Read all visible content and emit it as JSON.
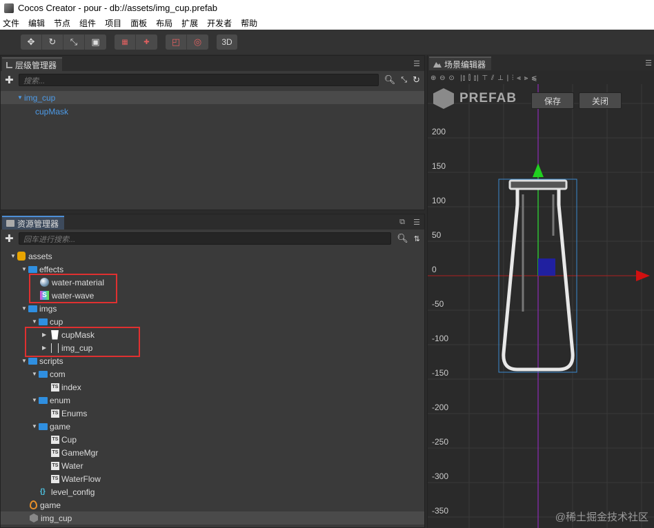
{
  "window": {
    "title": "Cocos Creator - pour - db://assets/img_cup.prefab"
  },
  "menu": [
    "文件",
    "编辑",
    "节点",
    "组件",
    "项目",
    "面板",
    "布局",
    "扩展",
    "开发者",
    "帮助"
  ],
  "toolbar": {
    "mode_3d": "3D"
  },
  "hierarchy": {
    "tab": "层级管理器",
    "search_placeholder": "搜索...",
    "nodes": [
      {
        "label": "img_cup"
      },
      {
        "label": "cupMask"
      }
    ]
  },
  "assets": {
    "tab": "资源管理器",
    "search_placeholder": "回车进行搜索...",
    "items": [
      {
        "label": "assets"
      },
      {
        "label": "effects"
      },
      {
        "label": "water-material"
      },
      {
        "label": "water-wave"
      },
      {
        "label": "imgs"
      },
      {
        "label": "cup"
      },
      {
        "label": "cupMask"
      },
      {
        "label": "img_cup"
      },
      {
        "label": "scripts"
      },
      {
        "label": "com"
      },
      {
        "label": "index"
      },
      {
        "label": "enum"
      },
      {
        "label": "Enums"
      },
      {
        "label": "game"
      },
      {
        "label": "Cup"
      },
      {
        "label": "GameMgr"
      },
      {
        "label": "Water"
      },
      {
        "label": "WaterFlow"
      },
      {
        "label": "level_config"
      },
      {
        "label": "game"
      },
      {
        "label": "img_cup"
      }
    ]
  },
  "scene": {
    "tab": "场景编辑器",
    "prefab_label": "PREFAB",
    "save_button": "保存",
    "close_button": "关闭",
    "ruler": [
      "200",
      "150",
      "100",
      "50",
      "0",
      "-50",
      "-100",
      "-150",
      "-200",
      "-250",
      "-300",
      "-350"
    ]
  },
  "watermark": "@稀土掘金技术社区"
}
